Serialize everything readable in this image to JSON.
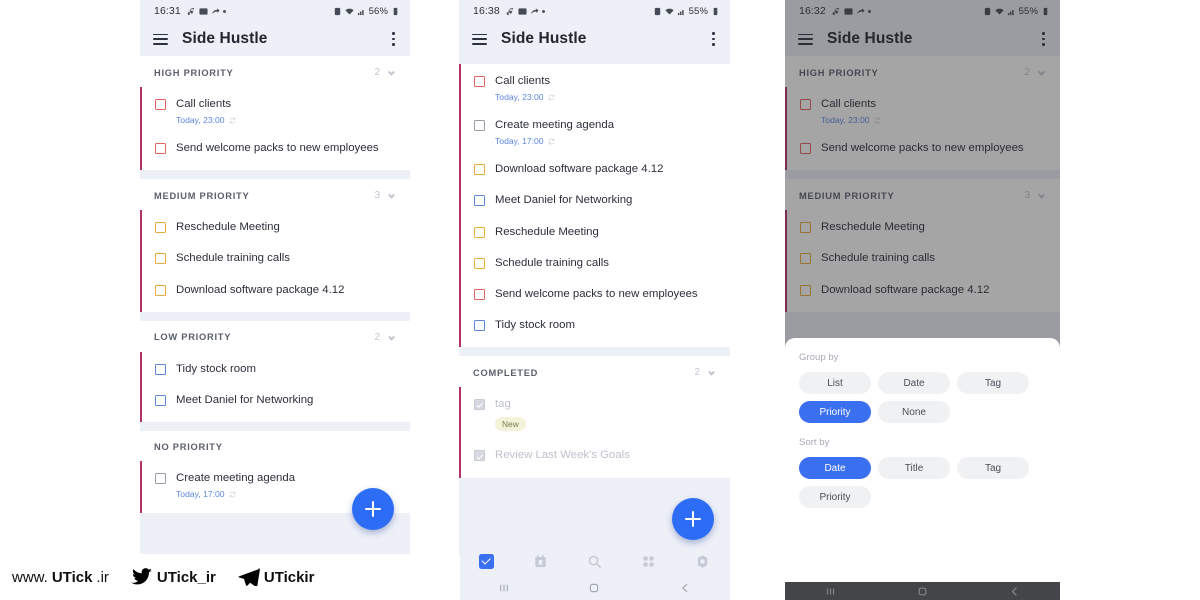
{
  "panels": [
    {
      "id": "panel-grouped-by-priority",
      "status": {
        "time": "16:31",
        "battery": "56%"
      },
      "appbar": {
        "title": "Side Hustle",
        "menu_icon": "hamburger-icon",
        "overflow_icon": "kebab-menu-icon"
      },
      "groups": [
        {
          "title": "HIGH PRIORITY",
          "count": "2",
          "tasks": [
            {
              "title": "Call clients",
              "meta": "Today, 23:00",
              "priority": "high",
              "repeat": true
            },
            {
              "title": "Send welcome packs to new employees",
              "meta": "",
              "priority": "high",
              "repeat": false
            }
          ]
        },
        {
          "title": "MEDIUM PRIORITY",
          "count": "3",
          "tasks": [
            {
              "title": "Reschedule Meeting",
              "meta": "",
              "priority": "medium",
              "repeat": false
            },
            {
              "title": "Schedule training calls",
              "meta": "",
              "priority": "medium",
              "repeat": false
            },
            {
              "title": "Download software package 4.12",
              "meta": "",
              "priority": "medium",
              "repeat": false
            }
          ]
        },
        {
          "title": "LOW PRIORITY",
          "count": "2",
          "tasks": [
            {
              "title": "Tidy stock room",
              "meta": "",
              "priority": "low",
              "repeat": false
            },
            {
              "title": "Meet Daniel for Networking",
              "meta": "",
              "priority": "low",
              "repeat": false
            }
          ]
        },
        {
          "title": "NO PRIORITY",
          "count": "",
          "tasks": [
            {
              "title": "Create meeting agenda",
              "meta": "Today, 17:00",
              "priority": "none",
              "repeat": true
            }
          ]
        }
      ],
      "fab": {
        "label": "+",
        "name": "add-task-fab"
      },
      "bottomnav": [
        "tasks-checkbox-icon",
        "calendar-icon",
        "search-icon",
        "grid-icon",
        "settings-icon"
      ],
      "sysnav": [
        "recents-icon",
        "home-icon",
        "back-icon"
      ]
    },
    {
      "id": "panel-sorted-by-date",
      "status": {
        "time": "16:38",
        "battery": "55%"
      },
      "appbar": {
        "title": "Side Hustle",
        "menu_icon": "hamburger-icon",
        "overflow_icon": "kebab-menu-icon"
      },
      "tasks": [
        {
          "title": "Call clients",
          "meta": "Today, 23:00",
          "priority": "high",
          "repeat": true
        },
        {
          "title": "Create meeting agenda",
          "meta": "Today, 17:00",
          "priority": "none",
          "repeat": true
        },
        {
          "title": "Download software package 4.12",
          "meta": "",
          "priority": "medium",
          "repeat": false
        },
        {
          "title": "Meet Daniel for Networking",
          "meta": "",
          "priority": "low",
          "repeat": false
        },
        {
          "title": "Reschedule Meeting",
          "meta": "",
          "priority": "medium",
          "repeat": false
        },
        {
          "title": "Schedule training calls",
          "meta": "",
          "priority": "medium",
          "repeat": false
        },
        {
          "title": "Send welcome packs to new employees",
          "meta": "",
          "priority": "high",
          "repeat": false
        },
        {
          "title": "Tidy stock room",
          "meta": "",
          "priority": "low",
          "repeat": false
        }
      ],
      "completed": {
        "title": "COMPLETED",
        "count": "2",
        "tasks": [
          {
            "title": "tag",
            "tag": "New"
          },
          {
            "title": "Review Last Week's Goals",
            "tag": ""
          }
        ]
      },
      "fab": {
        "label": "+",
        "name": "add-task-fab"
      },
      "bottomnav": [
        "tasks-checkbox-icon",
        "calendar-icon",
        "search-icon",
        "grid-icon",
        "settings-icon"
      ],
      "sysnav": [
        "recents-icon",
        "home-icon",
        "back-icon"
      ]
    },
    {
      "id": "panel-group-sort-sheet",
      "status": {
        "time": "16:32",
        "battery": "55%"
      },
      "appbar": {
        "title": "Side Hustle",
        "menu_icon": "hamburger-icon",
        "overflow_icon": "kebab-menu-icon"
      },
      "groups": [
        {
          "title": "HIGH PRIORITY",
          "count": "2",
          "tasks": [
            {
              "title": "Call clients",
              "meta": "Today, 23:00",
              "priority": "high",
              "repeat": true
            },
            {
              "title": "Send welcome packs to new employees",
              "meta": "",
              "priority": "high",
              "repeat": false
            }
          ]
        },
        {
          "title": "MEDIUM PRIORITY",
          "count": "3",
          "tasks": [
            {
              "title": "Reschedule Meeting",
              "meta": "",
              "priority": "medium",
              "repeat": false
            },
            {
              "title": "Schedule training calls",
              "meta": "",
              "priority": "medium",
              "repeat": false
            },
            {
              "title": "Download software package 4.12",
              "meta": "",
              "priority": "medium",
              "repeat": false
            }
          ]
        }
      ],
      "sheet": {
        "group_by_label": "Group by",
        "group_by_options": [
          {
            "label": "List",
            "selected": false
          },
          {
            "label": "Date",
            "selected": false
          },
          {
            "label": "Tag",
            "selected": false
          },
          {
            "label": "Priority",
            "selected": true
          },
          {
            "label": "None",
            "selected": false
          }
        ],
        "sort_by_label": "Sort by",
        "sort_by_options": [
          {
            "label": "Date",
            "selected": true
          },
          {
            "label": "Title",
            "selected": false
          },
          {
            "label": "Tag",
            "selected": false
          },
          {
            "label": "Priority",
            "selected": false
          }
        ]
      },
      "sysnav": [
        "recents-icon",
        "home-icon",
        "back-icon"
      ]
    }
  ],
  "watermark": {
    "site": {
      "prefix": "www.",
      "brand": "UTick",
      "suffix": ".ir"
    },
    "twitter": {
      "icon": "twitter-bird-icon",
      "handle": "UTick_ir"
    },
    "telegram": {
      "icon": "telegram-plane-icon",
      "handle": "UTickir"
    }
  },
  "colors": {
    "accent": "#3a6ff0",
    "group_bar": "#b5316b",
    "high": "#e2635f",
    "medium": "#e8ab3c",
    "low": "#5b86e0",
    "none": "#9a9da8",
    "page_bg": "#eef0f8",
    "meta_text": "#5b86e0",
    "tag_bg": "#f2f3d8"
  }
}
